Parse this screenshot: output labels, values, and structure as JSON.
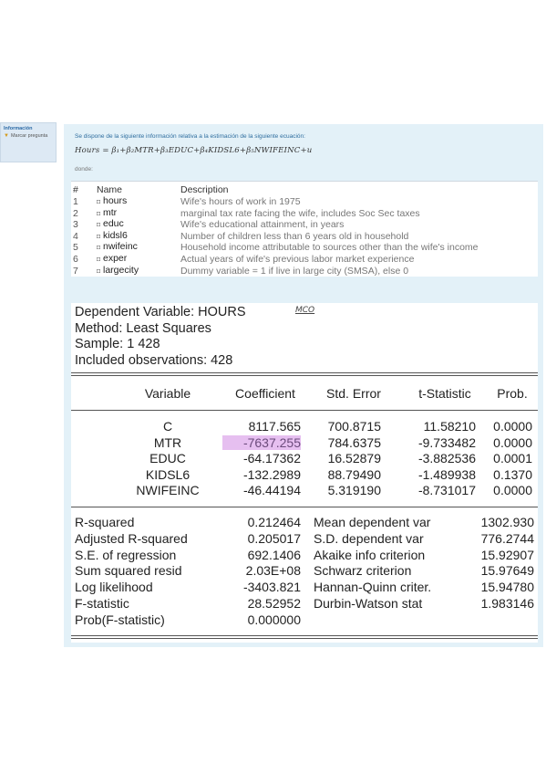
{
  "sidebar": {
    "info_title": "Información",
    "flag_label": "Marcar pregunta"
  },
  "question": {
    "intro": "Se dispone de la siguiente información relativa a la estimación de la siguiente ecuación:",
    "equation": "Hours = β₁+β₂MTR+β₃EDUC+β₄KIDSL6+β₅NWIFEINC+u",
    "donde": "donde:"
  },
  "variables": {
    "headers": [
      "#",
      "Name",
      "Description"
    ],
    "rows": [
      {
        "n": "1",
        "name": "hours",
        "desc": "Wife's hours of work in 1975"
      },
      {
        "n": "2",
        "name": "mtr",
        "desc": "marginal tax rate facing the wife, includes Soc Sec taxes"
      },
      {
        "n": "3",
        "name": "educ",
        "desc": "Wife's educational attainment, in years"
      },
      {
        "n": "4",
        "name": "kidsl6",
        "desc": "Number of children less than 6 years old in household"
      },
      {
        "n": "5",
        "name": "nwifeinc",
        "desc": "Household income attributable to sources other than the wife's income"
      },
      {
        "n": "6",
        "name": "exper",
        "desc": "Actual years of wife's previous labor market experience"
      },
      {
        "n": "7",
        "name": "largecity",
        "desc": "Dummy variable = 1 if live in large city (SMSA), else 0"
      }
    ]
  },
  "eviews": {
    "dependent": "Dependent Variable: HOURS",
    "method": "Method: Least Squares",
    "sample": "Sample: 1 428",
    "obs": "Included observations: 428",
    "scribble": "MCO",
    "coef_headers": [
      "Variable",
      "Coefficient",
      "Std. Error",
      "t-Statistic",
      "Prob."
    ],
    "coef_rows": [
      {
        "var": "C",
        "coef": "8117.565",
        "se": "700.8715",
        "t": "11.58210",
        "p": "0.0000"
      },
      {
        "var": "MTR",
        "coef": "-7637.255",
        "se": "784.6375",
        "t": "-9.733482",
        "p": "0.0000"
      },
      {
        "var": "EDUC",
        "coef": "-64.17362",
        "se": "16.52879",
        "t": "-3.882536",
        "p": "0.0001"
      },
      {
        "var": "KIDSL6",
        "coef": "-132.2989",
        "se": "88.79490",
        "t": "-1.489938",
        "p": "0.1370"
      },
      {
        "var": "NWIFEINC",
        "coef": "-46.44194",
        "se": "5.319190",
        "t": "-8.731017",
        "p": "0.0000"
      }
    ],
    "stats_rows": [
      {
        "l1": "R-squared",
        "v1": "0.212464",
        "l2": "Mean dependent var",
        "v2": "1302.930"
      },
      {
        "l1": "Adjusted R-squared",
        "v1": "0.205017",
        "l2": "S.D. dependent var",
        "v2": "776.2744"
      },
      {
        "l1": "S.E. of regression",
        "v1": "692.1406",
        "l2": "Akaike info criterion",
        "v2": "15.92907"
      },
      {
        "l1": "Sum squared resid",
        "v1": "2.03E+08",
        "l2": "Schwarz criterion",
        "v2": "15.97649"
      },
      {
        "l1": "Log likelihood",
        "v1": "-3403.821",
        "l2": "Hannan-Quinn criter.",
        "v2": "15.94780"
      },
      {
        "l1": "F-statistic",
        "v1": "28.52952",
        "l2": "Durbin-Watson stat",
        "v2": "1.983146"
      },
      {
        "l1": "Prob(F-statistic)",
        "v1": "0.000000",
        "l2": "",
        "v2": ""
      }
    ]
  }
}
